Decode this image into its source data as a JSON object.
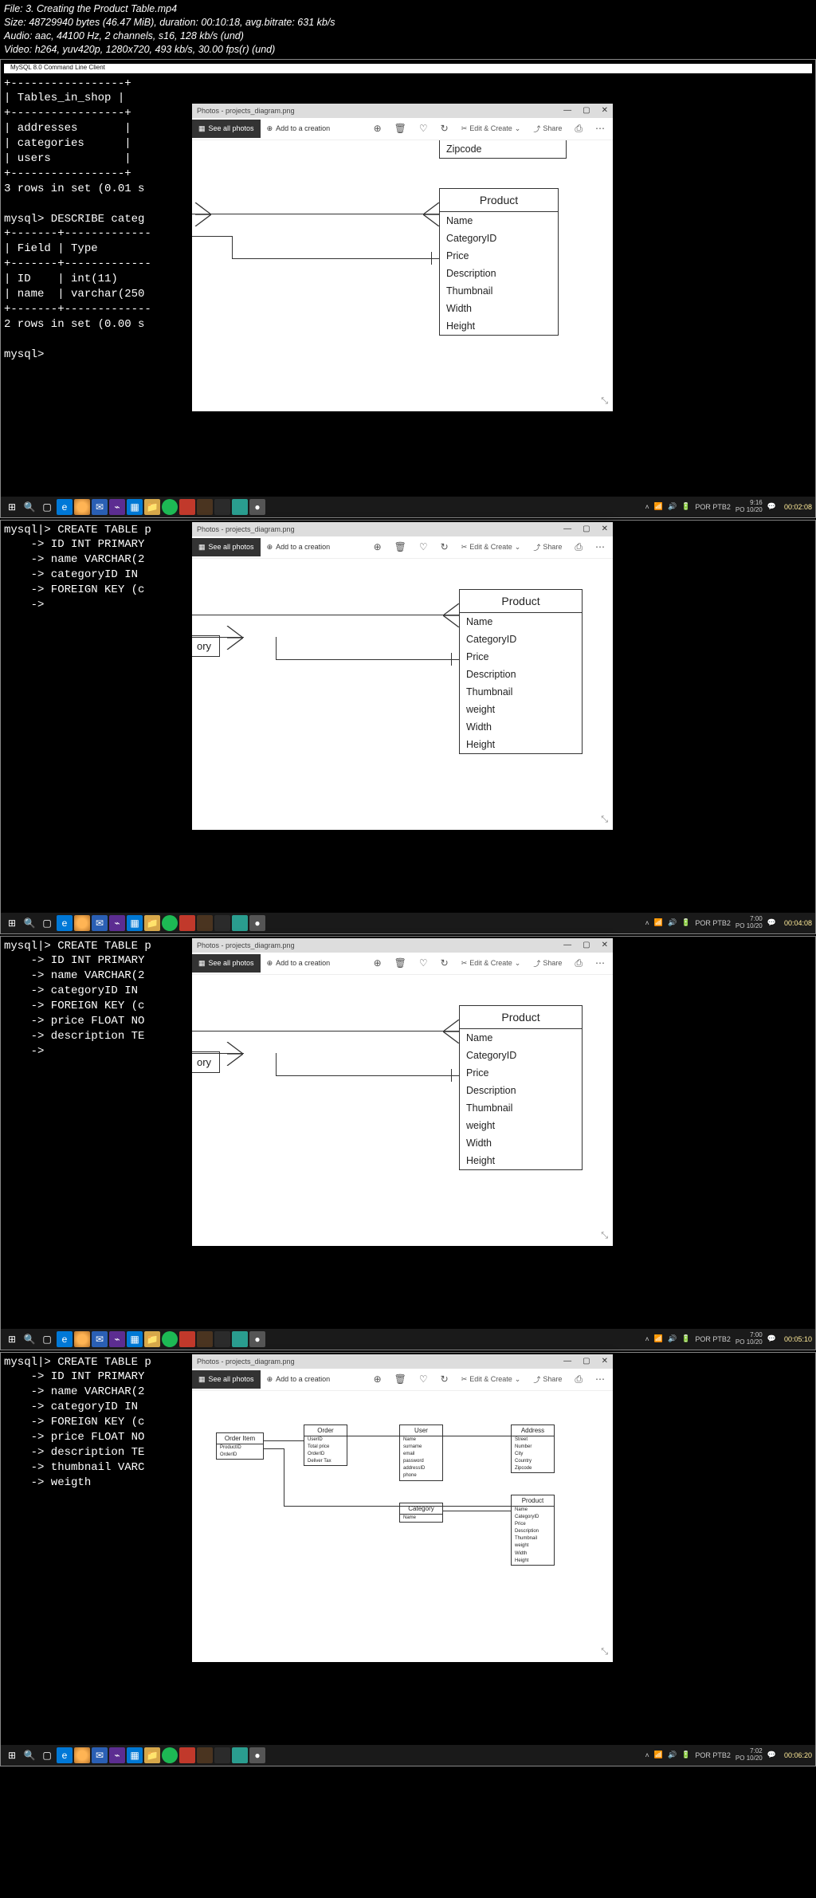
{
  "header": {
    "file": "File: 3. Creating the Product Table.mp4",
    "size": "Size: 48729940 bytes (46.47 MiB), duration: 00:10:18, avg.bitrate: 631 kb/s",
    "audio": "Audio: aac, 44100 Hz, 2 channels, s16, 128 kb/s (und)",
    "video": "Video: h264, yuv420p, 1280x720, 493 kb/s, 30.00 fps(r) (und)"
  },
  "photos": {
    "title": "Photos - projects_diagram.png",
    "see_all": "See all photos",
    "add_creation": "Add to a creation",
    "edit_create": "Edit & Create",
    "share": "Share",
    "dropdown": "⌄"
  },
  "frame0": {
    "terminal": "+-----------------+\n| Tables_in_shop |\n+-----------------+\n| addresses       |\n| categories      |\n| users           |\n+-----------------+\n3 rows in set (0.01 s\n\nmysql> DESCRIBE categ\n+-------+-------------\n| Field | Type\n+-------+-------------\n| ID    | int(11)\n| name  | varchar(250\n+-------+-------------\n2 rows in set (0.00 s\n\nmysql>",
    "product_title": "Product",
    "fields": [
      "Name",
      "CategoryID",
      "Price",
      "Description",
      "Thumbnail",
      "Width",
      "Height"
    ],
    "topbox": "Zipcode",
    "timestamp": "00:02:08"
  },
  "frame1": {
    "terminal": "mysql|> CREATE TABLE p\n    -> ID INT PRIMARY\n    -> name VARCHAR(2\n    -> categoryID IN\n    -> FOREIGN KEY (c\n    ->",
    "product_title": "Product",
    "fields": [
      "Name",
      "CategoryID",
      "Price",
      "Description",
      "Thumbnail",
      "weight",
      "Width",
      "Height"
    ],
    "ory": "ory",
    "timestamp": "00:04:08"
  },
  "frame2": {
    "terminal": "mysql|> CREATE TABLE p\n    -> ID INT PRIMARY\n    -> name VARCHAR(2\n    -> categoryID IN\n    -> FOREIGN KEY (c\n    -> price FLOAT NO\n    -> description TE\n    ->",
    "product_title": "Product",
    "fields": [
      "Name",
      "CategoryID",
      "Price",
      "Description",
      "Thumbnail",
      "weight",
      "Width",
      "Height"
    ],
    "ory": "ory",
    "timestamp": "00:05:10"
  },
  "frame3": {
    "terminal": "mysql|> CREATE TABLE p\n    -> ID INT PRIMARY\n    -> name VARCHAR(2\n    -> categoryID IN\n    -> FOREIGN KEY (c\n    -> price FLOAT NO\n    -> description TE\n    -> thumbnail VARC\n    -> weigth",
    "timestamp": "00:06:20",
    "entities": {
      "order_item": {
        "title": "Order Item",
        "fields": [
          "ProductID",
          "OrderID"
        ]
      },
      "order": {
        "title": "Order",
        "fields": [
          "UserID",
          "Total price",
          "OrderID",
          "Deliver Tax"
        ]
      },
      "user": {
        "title": "User",
        "fields": [
          "Name",
          "surname",
          "email",
          "password",
          "addressID",
          "phone"
        ]
      },
      "address": {
        "title": "Address",
        "fields": [
          "Street",
          "Number",
          "City",
          "Country",
          "Zipcode"
        ]
      },
      "category": {
        "title": "Category",
        "fields": [
          "Name"
        ]
      },
      "product": {
        "title": "Product",
        "fields": [
          "Name",
          "CategoryID",
          "Price",
          "Description",
          "Thumbnail",
          "weight",
          "Width",
          "Height"
        ]
      }
    }
  },
  "taskbar": {
    "time1": {
      "l1": "9:16",
      "l2": "PO 10/20",
      "lang": "POR PTB2"
    },
    "time2": {
      "l1": "7:00",
      "l2": "PO 10/20",
      "lang": "POR PTB2"
    },
    "time3": {
      "l1": "7:00",
      "l2": "PO 10/20",
      "lang": "POR PTB2"
    },
    "time4": {
      "l1": "7:02",
      "l2": "PO 10/20",
      "lang": "POR PTB2"
    }
  }
}
